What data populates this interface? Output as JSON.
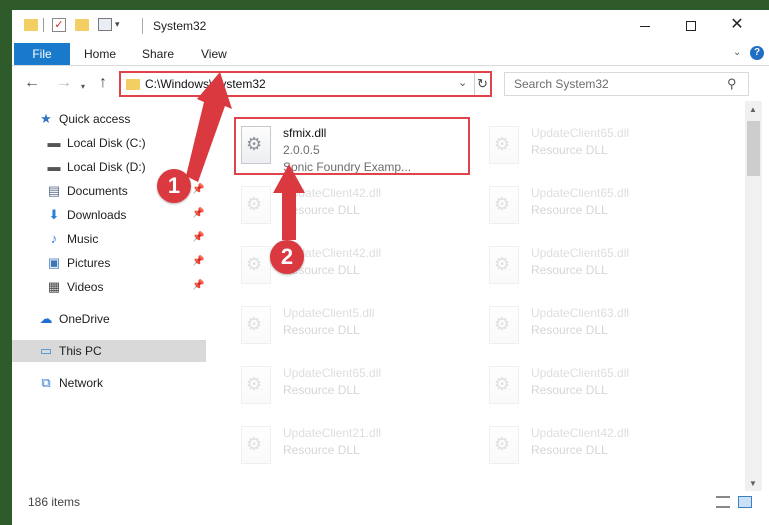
{
  "window": {
    "title": "System32",
    "controls": {
      "minimize": "minimize",
      "maximize": "maximize",
      "close": "✕"
    }
  },
  "ribbon": {
    "file": "File",
    "tabs": [
      "Home",
      "Share",
      "View"
    ],
    "help": "?"
  },
  "address": {
    "path": "C:\\Windows\\System32",
    "refresh": "↻"
  },
  "search": {
    "placeholder": "Search System32"
  },
  "sidebar": {
    "items": [
      {
        "label": "Quick access",
        "icon": "star-icon",
        "pinned": false
      },
      {
        "label": "Local Disk (C:)",
        "icon": "disk-icon",
        "pinned": true
      },
      {
        "label": "Local Disk (D:)",
        "icon": "disk-icon",
        "pinned": true
      },
      {
        "label": "Documents",
        "icon": "documents-icon",
        "pinned": true
      },
      {
        "label": "Downloads",
        "icon": "download-icon",
        "pinned": true
      },
      {
        "label": "Music",
        "icon": "music-icon",
        "pinned": true
      },
      {
        "label": "Pictures",
        "icon": "pictures-icon",
        "pinned": true
      },
      {
        "label": "Videos",
        "icon": "videos-icon",
        "pinned": true
      },
      {
        "label": "OneDrive",
        "icon": "cloud-icon",
        "pinned": false
      },
      {
        "label": "This PC",
        "icon": "pc-icon",
        "pinned": false,
        "selected": true
      },
      {
        "label": "Network",
        "icon": "network-icon",
        "pinned": false
      }
    ]
  },
  "files": {
    "highlighted": {
      "name": "sfmix.dll",
      "version": "2.0.0.5",
      "description": "Sonic Foundry Examp..."
    },
    "left": [
      {
        "name": "UpdateClient42.dll",
        "type": "Resource DLL"
      },
      {
        "name": "UpdateClient42.dll",
        "type": "Resource DLL"
      },
      {
        "name": "UpdateClient5.dll",
        "type": "Resource DLL"
      },
      {
        "name": "UpdateClient65.dll",
        "type": "Resource DLL"
      },
      {
        "name": "UpdateClient21.dll",
        "type": "Resource DLL"
      }
    ],
    "right": [
      {
        "name": "UpdateClient65.dll",
        "type": "Resource DLL"
      },
      {
        "name": "UpdateClient65.dll",
        "type": "Resource DLL"
      },
      {
        "name": "UpdateClient65.dll",
        "type": "Resource DLL"
      },
      {
        "name": "UpdateClient63.dll",
        "type": "Resource DLL"
      },
      {
        "name": "UpdateClient65.dll",
        "type": "Resource DLL"
      },
      {
        "name": "UpdateClient42.dll",
        "type": "Resource DLL"
      }
    ]
  },
  "status": {
    "count": "186 items"
  },
  "annotations": {
    "badge1": "1",
    "badge2": "2",
    "highlight_color": "#e0444a",
    "badge_color": "#d9393f"
  },
  "colors": {
    "file_tab": "#1979ca",
    "selected_nav": "#d9d9d9"
  }
}
